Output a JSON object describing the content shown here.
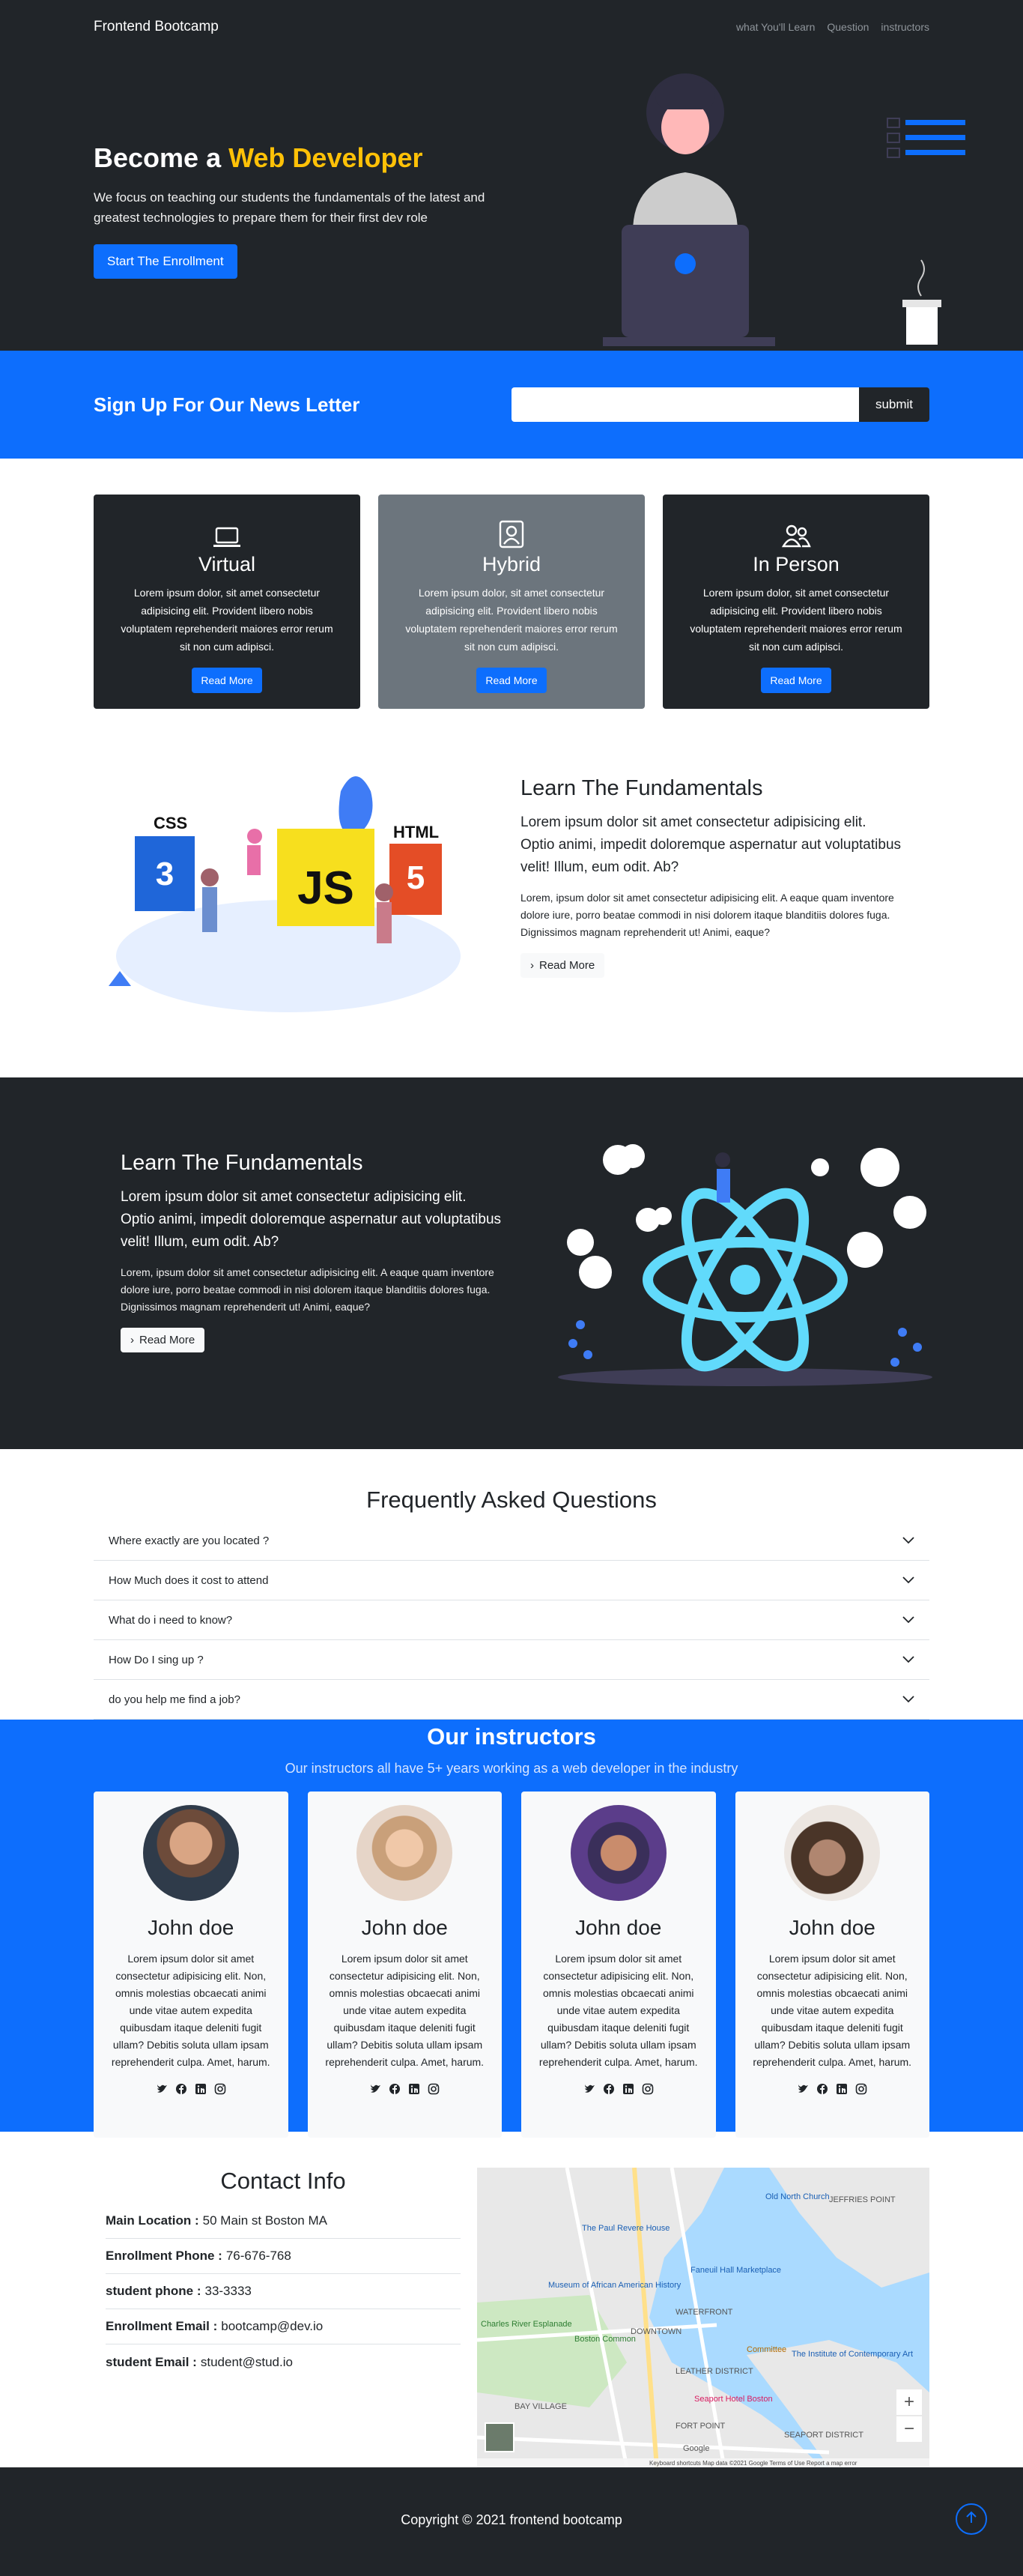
{
  "nav": {
    "brand": "Frontend Bootcamp",
    "links": [
      "what You'll Learn",
      "Question",
      "instructors"
    ]
  },
  "hero": {
    "title_prefix": "Become a ",
    "title_accent": "Web Developer",
    "subtitle": "We focus on teaching our students the fundamentals of the latest and greatest technologies to prepare them for their first dev role",
    "button": "Start The Enrollment"
  },
  "newsletter": {
    "title": "Sign Up For Our News Letter",
    "input_value": "",
    "button": "submit"
  },
  "cards": [
    {
      "icon": "laptop-icon",
      "title": "Virtual",
      "text": "Lorem ipsum dolor, sit amet consectetur adipisicing elit. Provident libero nobis voluptatem reprehenderit maiores error rerum sit non cum adipisci.",
      "button": "Read More"
    },
    {
      "icon": "person-badge-icon",
      "title": "Hybrid",
      "text": "Lorem ipsum dolor, sit amet consectetur adipisicing elit. Provident libero nobis voluptatem reprehenderit maiores error rerum sit non cum adipisci.",
      "button": "Read More"
    },
    {
      "icon": "people-icon",
      "title": "In Person",
      "text": "Lorem ipsum dolor, sit amet consectetur adipisicing elit. Provident libero nobis voluptatem reprehenderit maiores error rerum sit non cum adipisci.",
      "button": "Read More"
    }
  ],
  "learn1": {
    "title": "Learn The Fundamentals",
    "lead": "Lorem ipsum dolor sit amet consectetur adipisicing elit. Optio animi, impedit doloremque aspernatur aut voluptatibus velit! Illum, eum odit. Ab?",
    "text": "Lorem, ipsum dolor sit amet consectetur adipisicing elit. A eaque quam inventore dolore iure, porro beatae commodi in nisi dolorem itaque blanditiis dolores fuga. Dignissimos magnam reprehenderit ut! Animi, eaque?",
    "button": "Read More",
    "illus_labels": [
      "CSS",
      "JS",
      "HTML"
    ]
  },
  "learn2": {
    "title": "Learn The Fundamentals",
    "lead": "Lorem ipsum dolor sit amet consectetur adipisicing elit. Optio animi, impedit doloremque aspernatur aut voluptatibus velit! Illum, eum odit. Ab?",
    "text": "Lorem, ipsum dolor sit amet consectetur adipisicing elit. A eaque quam inventore dolore iure, porro beatae commodi in nisi dolorem itaque blanditiis dolores fuga. Dignissimos magnam reprehenderit ut! Animi, eaque?",
    "button": "Read More"
  },
  "faq": {
    "title": "Frequently Asked Questions",
    "items": [
      "Where exactly are you located ?",
      "How Much does it cost to attend",
      "What do i need to know?",
      "How Do I sing up ?",
      "do you help me find a job?"
    ]
  },
  "instructors": {
    "title": "Our instructors",
    "subtitle": "Our instructors all have 5+ years working as a web developer in the industry",
    "people": [
      {
        "name": "John doe",
        "bio": "Lorem ipsum dolor sit amet consectetur adipisicing elit. Non, omnis molestias obcaecati animi unde vitae autem expedita quibusdam itaque deleniti fugit ullam? Debitis soluta ullam ipsam reprehenderit culpa. Amet, harum.",
        "avatar_color": "#6d4b3a"
      },
      {
        "name": "John doe",
        "bio": "Lorem ipsum dolor sit amet consectetur adipisicing elit. Non, omnis molestias obcaecati animi unde vitae autem expedita quibusdam itaque deleniti fugit ullam? Debitis soluta ullam ipsam reprehenderit culpa. Amet, harum.",
        "avatar_color": "#d9b59a"
      },
      {
        "name": "John doe",
        "bio": "Lorem ipsum dolor sit amet consectetur adipisicing elit. Non, omnis molestias obcaecati animi unde vitae autem expedita quibusdam itaque deleniti fugit ullam? Debitis soluta ullam ipsam reprehenderit culpa. Amet, harum.",
        "avatar_color": "#3a2f5a"
      },
      {
        "name": "John doe",
        "bio": "Lorem ipsum dolor sit amet consectetur adipisicing elit. Non, omnis molestias obcaecati animi unde vitae autem expedita quibusdam itaque deleniti fugit ullam? Debitis soluta ullam ipsam reprehenderit culpa. Amet, harum.",
        "avatar_color": "#8a6a55"
      }
    ],
    "social_icons": [
      "twitter-icon",
      "facebook-icon",
      "linkedin-icon",
      "instagram-icon"
    ]
  },
  "contact": {
    "title": "Contact Info",
    "rows": [
      {
        "label": "Main Location :",
        "value": "50 Main st Boston MA"
      },
      {
        "label": "Enrollment Phone :",
        "value": "76-676-768"
      },
      {
        "label": "student phone :",
        "value": "33-3333"
      },
      {
        "label": "Enrollment Email :",
        "value": "bootcamp@dev.io"
      },
      {
        "label": "student Email :",
        "value": "student@stud.io"
      }
    ],
    "map_labels": [
      "Old North Church",
      "JEFFRIES POINT",
      "The Paul Revere House",
      "Faneuil Hall Marketplace",
      "Museum of African American History",
      "WATERFRONT",
      "Charles River Esplanade",
      "Boston Common",
      "DOWNTOWN",
      "Committee",
      "The Institute of Contemporary Art",
      "LEATHER DISTRICT",
      "Seaport Hotel Boston",
      "BAY VILLAGE",
      "FORT POINT",
      "SEAPORT DISTRICT",
      "Google"
    ],
    "map_footer": "Keyboard shortcuts   Map data ©2021 Google   Terms of Use   Report a map error",
    "zoom_in": "+",
    "zoom_out": "−"
  },
  "footer": {
    "copyright": "Copyright © 2021 frontend bootcamp"
  },
  "colors": {
    "primary": "#0d6efd",
    "dark": "#212529",
    "accent": "#ffc107",
    "gray": "#6c757d"
  }
}
